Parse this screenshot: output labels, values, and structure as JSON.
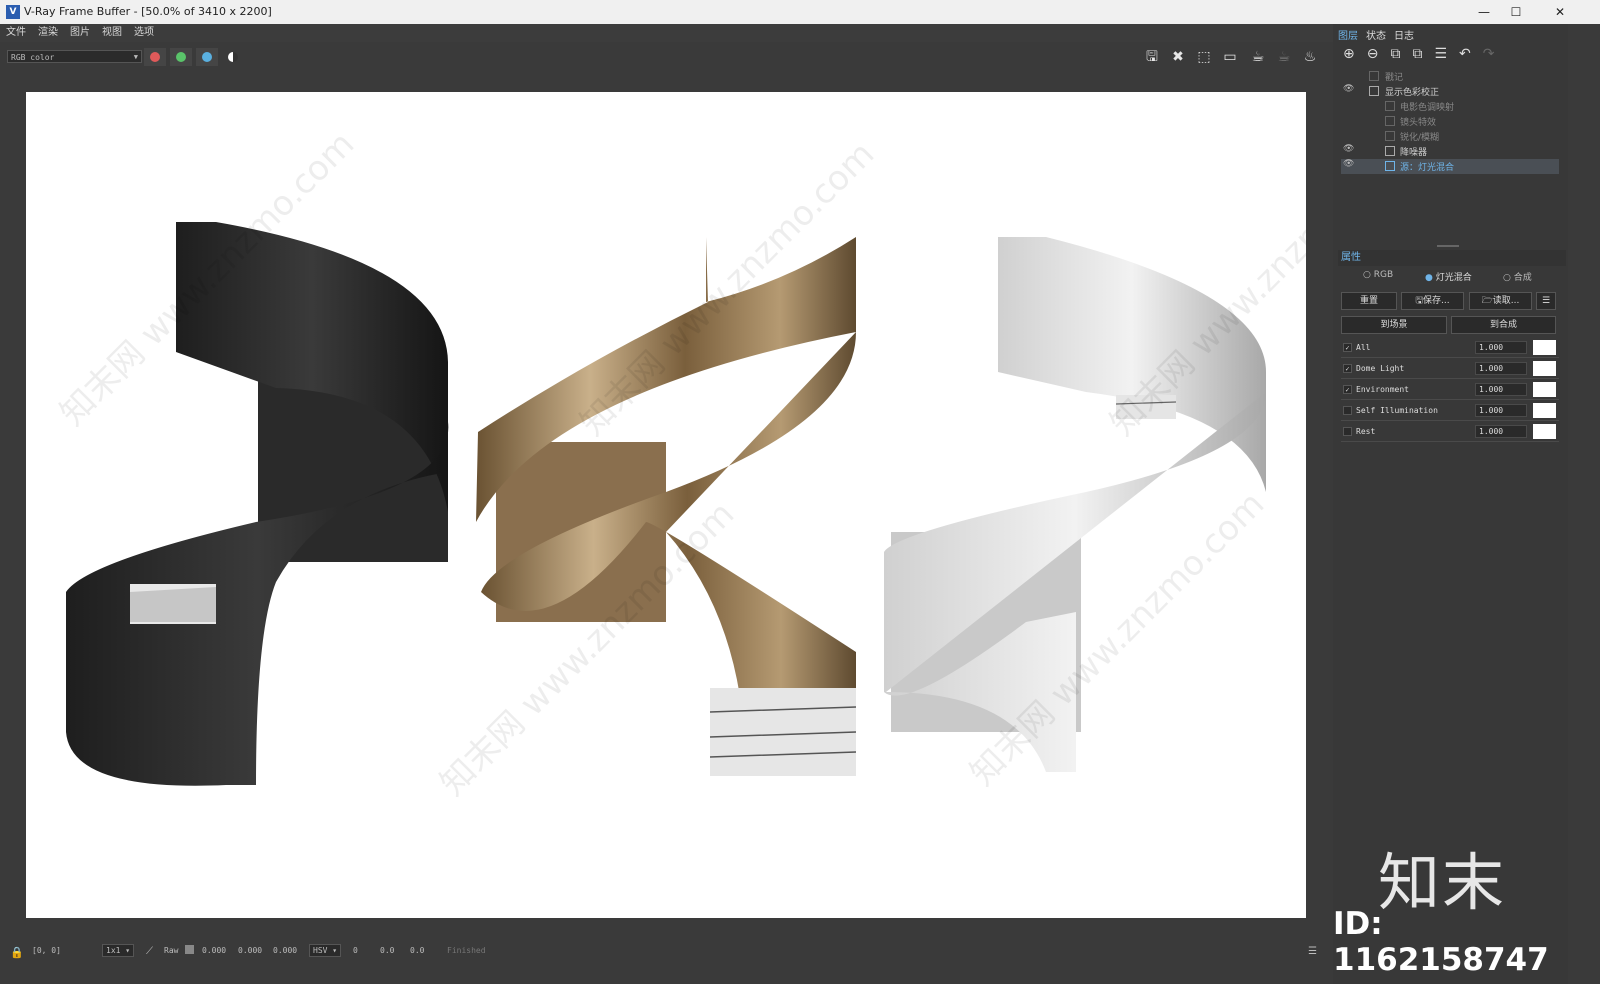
{
  "window": {
    "title": "V-Ray Frame Buffer - [50.0% of 3410 x 2200]",
    "app_icon": "V",
    "minimize": "—",
    "maximize": "☐",
    "close": "✕"
  },
  "menu": [
    "文件",
    "渲染",
    "图片",
    "视图",
    "选项"
  ],
  "toolbar": {
    "channel": "RGB color",
    "channel_colors": [
      "#e05a5a",
      "#5ac46a",
      "#5ab0e0"
    ]
  },
  "panel": {
    "tabs": [
      "图层",
      "状态",
      "日志"
    ],
    "layers": [
      {
        "label": "戳记",
        "visible": false,
        "dim": true
      },
      {
        "label": "显示色彩校正",
        "visible": true,
        "dim": false
      },
      {
        "label": "电影色调映射",
        "visible": false,
        "dim": true
      },
      {
        "label": "镜头特效",
        "visible": false,
        "dim": true
      },
      {
        "label": "锐化/模糊",
        "visible": false,
        "dim": true
      },
      {
        "label": "降噪器",
        "visible": true,
        "dim": false
      },
      {
        "label": "源：灯光混合",
        "visible": true,
        "dim": false,
        "selected": true
      }
    ],
    "properties_title": "属性",
    "modes": [
      "RGB",
      "灯光混合",
      "合成"
    ],
    "buttons": {
      "reset": "重置",
      "save": "保存...",
      "load": "读取...",
      "to_scene": "到场景",
      "to_comp": "到合成"
    },
    "lights": [
      {
        "name": "All",
        "value": "1.000",
        "checked": true
      },
      {
        "name": "Dome Light",
        "value": "1.000",
        "checked": true
      },
      {
        "name": "Environment",
        "value": "1.000",
        "checked": true
      },
      {
        "name": "Self Illumination",
        "value": "1.000",
        "checked": false
      },
      {
        "name": "Rest",
        "value": "1.000",
        "checked": false
      }
    ]
  },
  "status": {
    "coords": "[0, 0]",
    "zoom": "1x1",
    "mode": "Raw",
    "r": "0.000",
    "g": "0.000",
    "b": "0.000",
    "space": "HSV",
    "h": "0",
    "s": "0.0",
    "v": "0.0",
    "state": "Finished"
  },
  "watermark": {
    "site": "知末网 www.znzmo.com",
    "brand": "知末",
    "id": "ID: 1162158747"
  }
}
